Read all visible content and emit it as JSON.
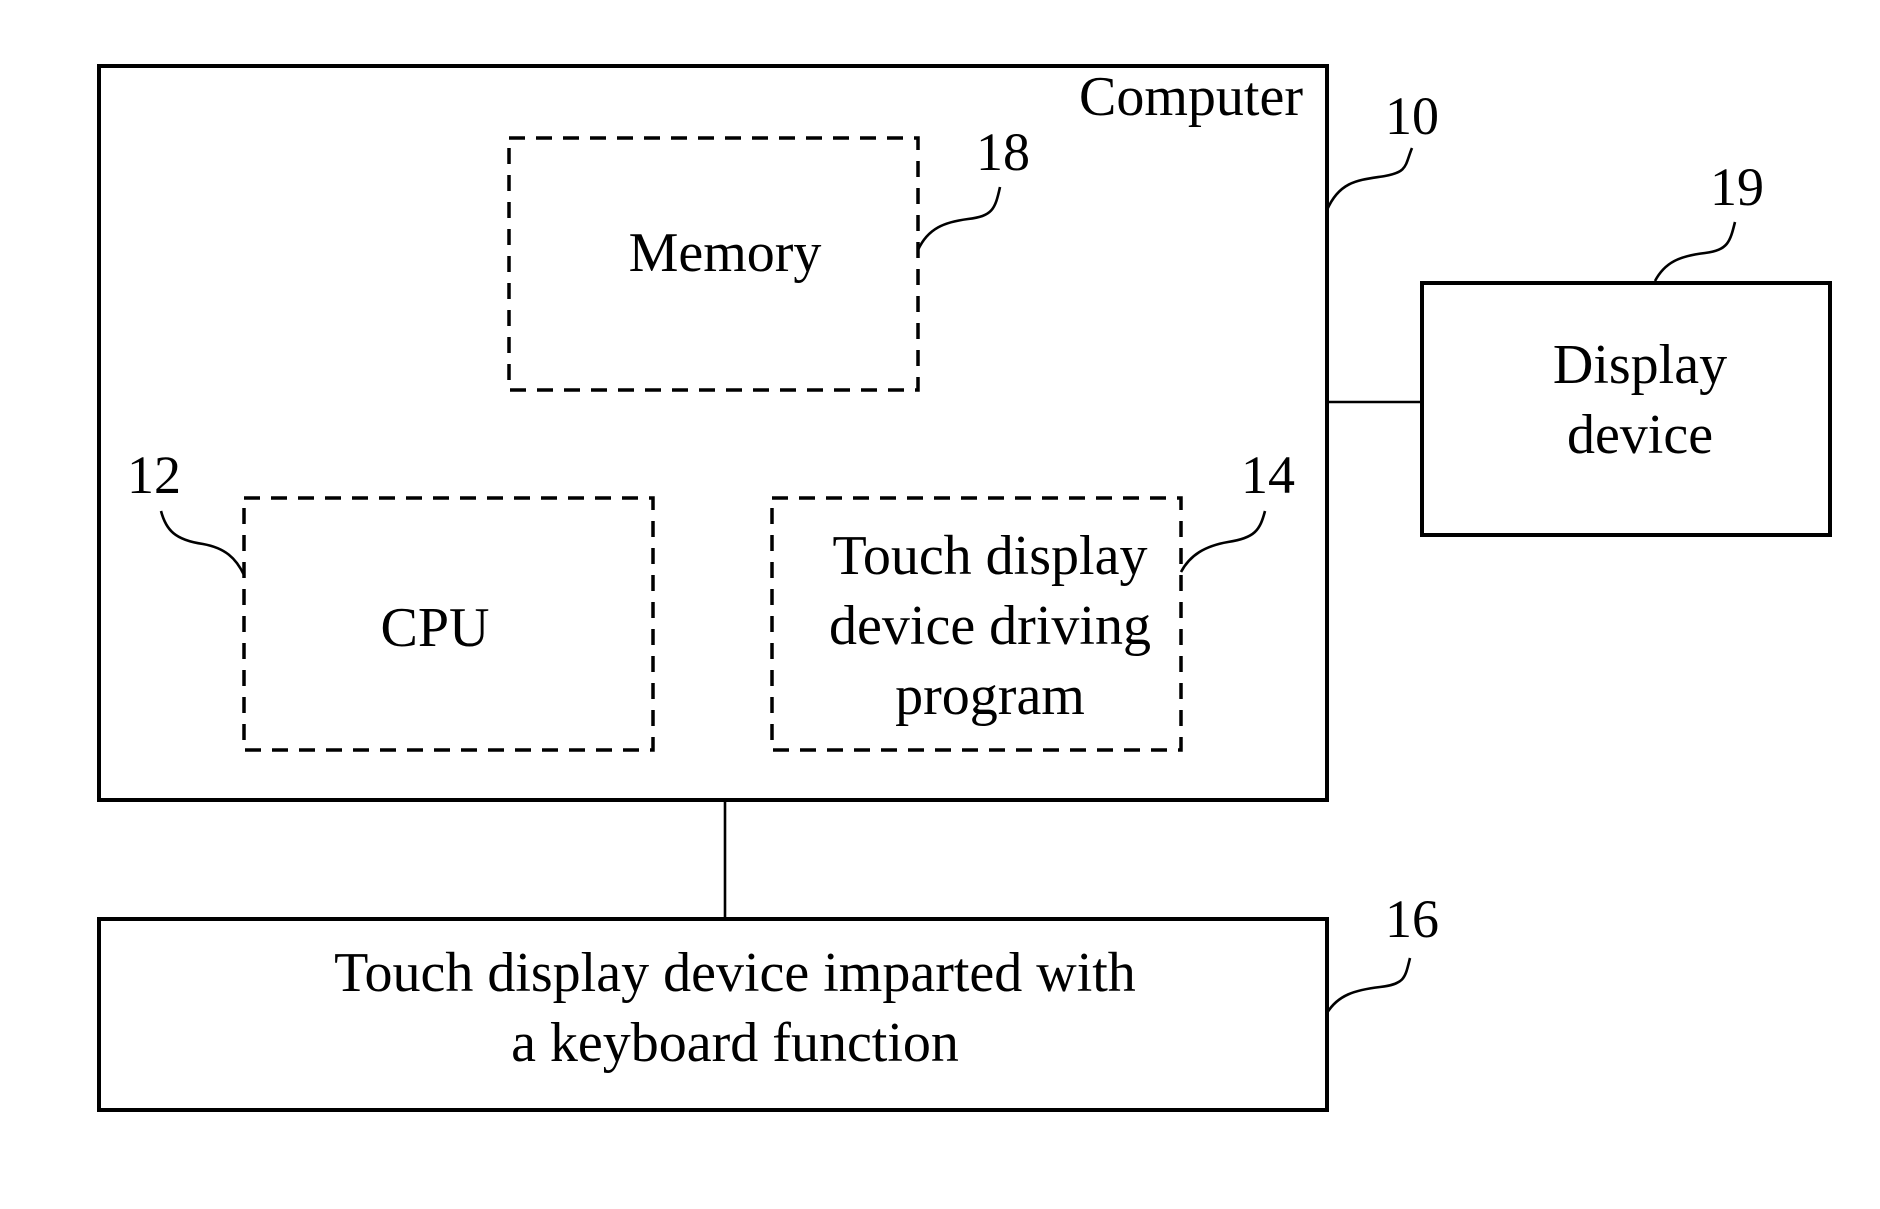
{
  "diagram": {
    "type": "block-diagram",
    "nodes": {
      "computer": {
        "label": "Computer",
        "ref": "10"
      },
      "memory": {
        "label": "Memory",
        "ref": "18"
      },
      "cpu": {
        "label": "CPU",
        "ref": "12"
      },
      "driver": {
        "label_lines": [
          "Touch display",
          "device driving",
          "program"
        ],
        "ref": "14"
      },
      "display": {
        "label_lines": [
          "Display",
          "device"
        ],
        "ref": "19"
      },
      "touch_device": {
        "label_lines": [
          "Touch display device imparted with",
          "a keyboard function"
        ],
        "ref": "16"
      }
    },
    "edges": [
      {
        "from": "computer",
        "to": "display_device"
      },
      {
        "from": "computer",
        "to": "touch_display_device"
      }
    ]
  }
}
